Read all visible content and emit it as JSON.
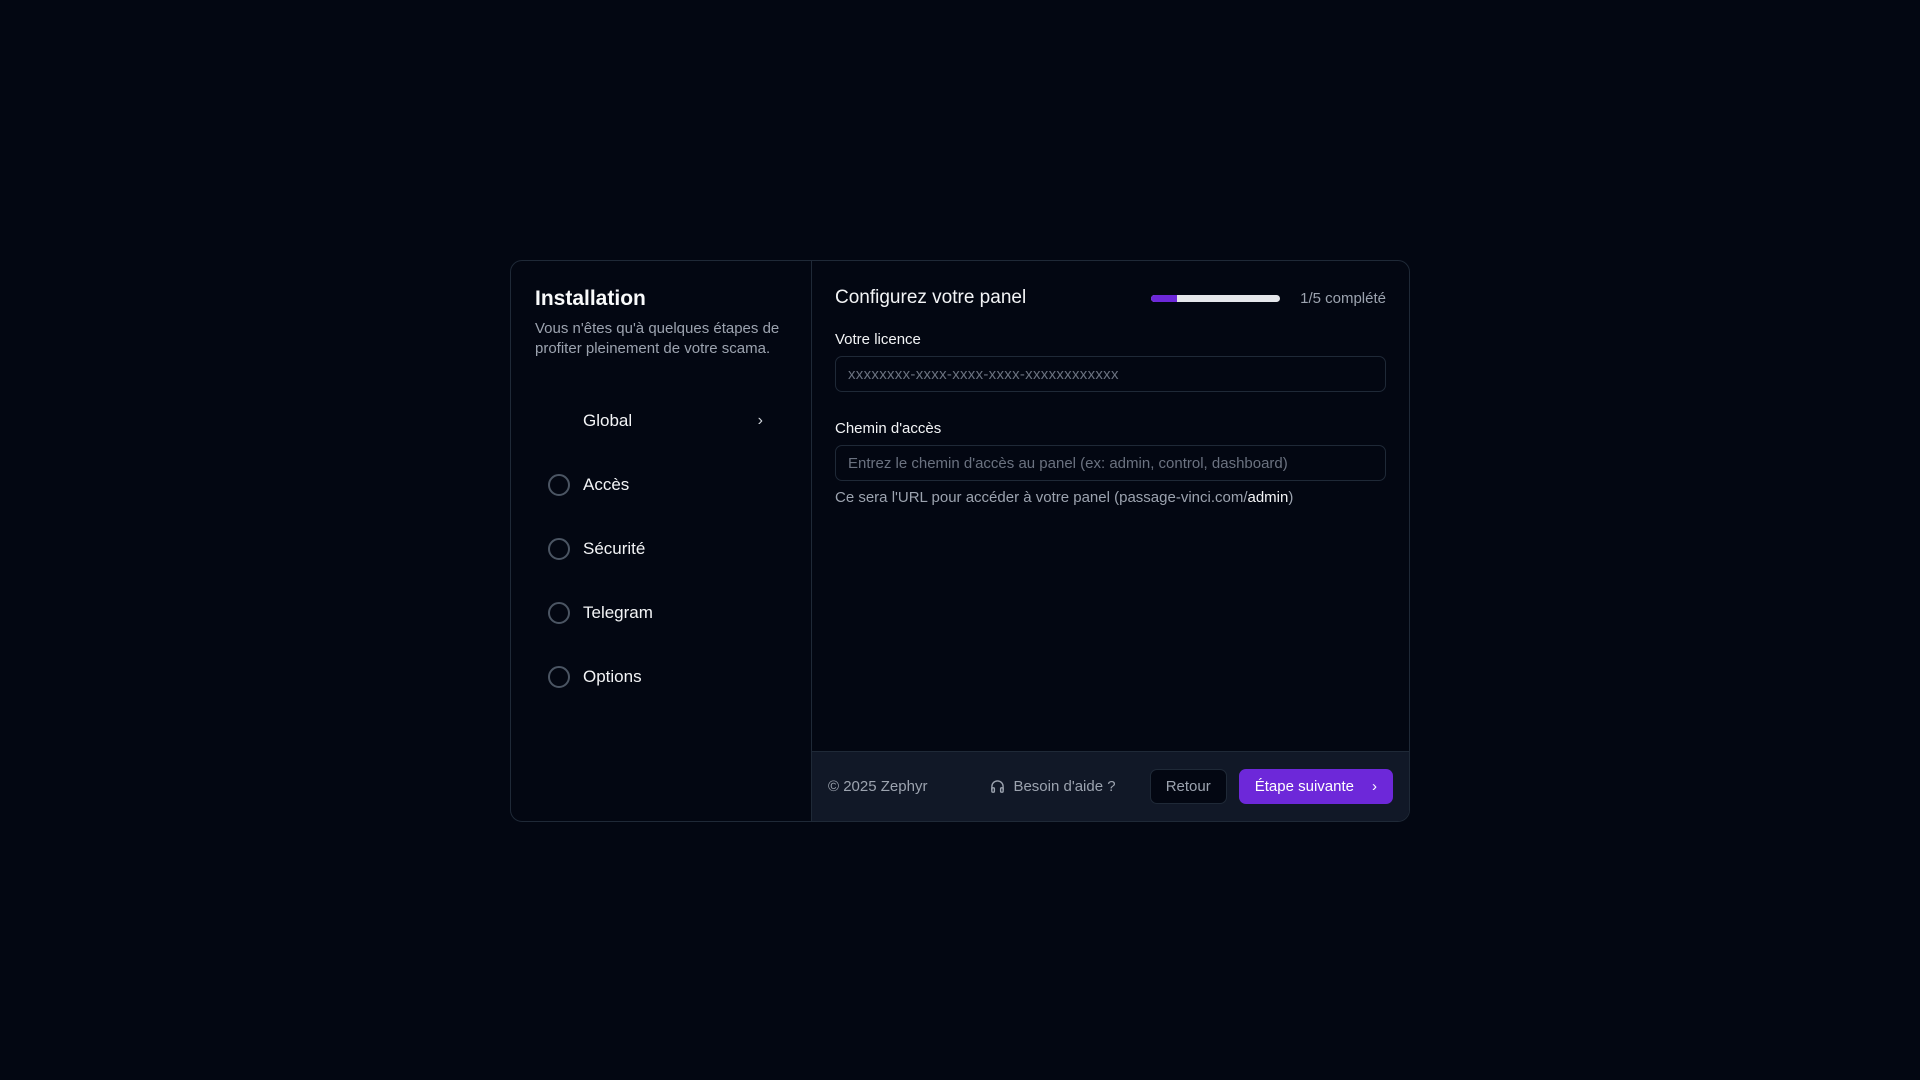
{
  "sidebar": {
    "title": "Installation",
    "subtitle": "Vous n'êtes qu'à quelques étapes de profiter pleinement de votre scama.",
    "steps": [
      {
        "label": "Global",
        "active": true
      },
      {
        "label": "Accès"
      },
      {
        "label": "Sécurité"
      },
      {
        "label": "Telegram"
      },
      {
        "label": "Options"
      }
    ]
  },
  "main": {
    "title": "Configurez votre panel",
    "progress": {
      "fraction": 0.2,
      "label": "1/5 complété"
    },
    "license": {
      "label": "Votre licence",
      "placeholder": "xxxxxxxx-xxxx-xxxx-xxxx-xxxxxxxxxxxx",
      "value": ""
    },
    "path": {
      "label": "Chemin d'accès",
      "placeholder": "Entrez le chemin d'accès au panel (ex: admin, control, dashboard)",
      "value": "",
      "help_prefix": "Ce sera l'URL pour accéder à votre panel (passage-vinci.com/",
      "help_path": "admin",
      "help_suffix": ")"
    }
  },
  "footer": {
    "copyright": "© 2025 Zephyr",
    "help": "Besoin d'aide ?",
    "back": "Retour",
    "next": "Étape suivante"
  },
  "colors": {
    "accent": "#6d28d9",
    "background": "#030712"
  }
}
